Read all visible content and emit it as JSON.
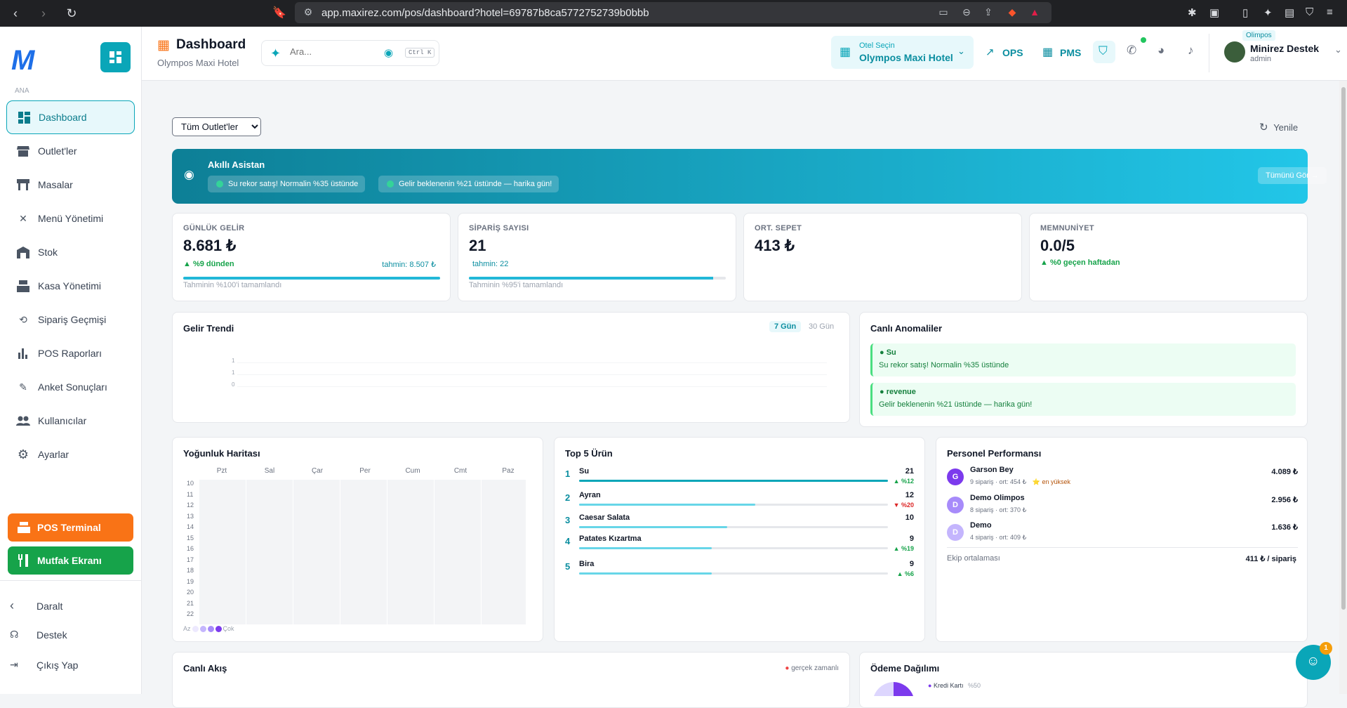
{
  "browser": {
    "url": "app.maxirez.com/pos/dashboard?hotel=69787b8ca5772752739b0bbb"
  },
  "sidebar": {
    "section_label": "ANA",
    "items": [
      {
        "label": "Dashboard",
        "icon": "dashboard-icon"
      },
      {
        "label": "Outlet'ler",
        "icon": "store-icon"
      },
      {
        "label": "Masalar",
        "icon": "table-icon"
      },
      {
        "label": "Menü Yönetimi",
        "icon": "utensils-icon"
      },
      {
        "label": "Stok",
        "icon": "warehouse-icon"
      },
      {
        "label": "Kasa Yönetimi",
        "icon": "cash-register-icon"
      },
      {
        "label": "Sipariş Geçmişi",
        "icon": "history-icon"
      },
      {
        "label": "POS Raporları",
        "icon": "bar-chart-icon"
      },
      {
        "label": "Anket Sonuçları",
        "icon": "survey-icon"
      },
      {
        "label": "Kullanıcılar",
        "icon": "users-icon"
      },
      {
        "label": "Ayarlar",
        "icon": "gear-icon"
      }
    ],
    "pos_terminal": "POS Terminal",
    "mutfak_ekrani": "Mutfak Ekranı",
    "collapse": "Daralt",
    "support": "Destek",
    "logout": "Çıkış Yap",
    "pos_color": "#f97316",
    "mutfak_color": "#16a34a"
  },
  "header": {
    "title": "Dashboard",
    "subtitle": "Olympos Maxi Hotel",
    "search_placeholder": "Ara...",
    "search_shortcut": "Ctrl K",
    "hotel_label": "Otel Seçin",
    "hotel_value": "Olympos Maxi Hotel",
    "ops": "OPS",
    "pms": "PMS",
    "user_name": "Minirez Destek",
    "user_role": "admin",
    "tenant": "Olimpos"
  },
  "toolbar": {
    "outlet_select": "Tüm Outlet'ler",
    "refresh": "Yenile"
  },
  "assistant": {
    "title": "Akıllı Asistan",
    "chips": [
      "Su rekor satış! Normalin %35 üstünde",
      "Gelir beklenenin %21 üstünde — harika gün!"
    ],
    "see_all": "Tümünü Gör →"
  },
  "kpis": [
    {
      "label": "GÜNLÜK GELİR",
      "value": "8.681 ₺",
      "delta": "▲ %9 dünden",
      "forecast": "tahmin: 8.507 ₺",
      "footer": "Tahminin %100'i tamamlandı",
      "progress": 100
    },
    {
      "label": "SİPARİŞ SAYISI",
      "value": "21",
      "delta": "",
      "forecast": "tahmin: 22",
      "footer": "Tahminin %95'i tamamlandı",
      "progress": 95
    },
    {
      "label": "ORT. SEPET",
      "value": "413 ₺"
    },
    {
      "label": "MEMNUNİYET",
      "value": "0.0/5",
      "delta": "▲ %0 geçen haftadan"
    }
  ],
  "trend": {
    "title": "Gelir Trendi",
    "range_7": "7 Gün",
    "range_30": "30 Gün",
    "ticks": [
      "1",
      "1",
      "0"
    ]
  },
  "anomalies": {
    "title": "Canlı Anomaliler",
    "items": [
      {
        "head": "Su",
        "body": "Su rekor satış! Normalin %35 üstünde"
      },
      {
        "head": "revenue",
        "body": "Gelir beklenenin %21 üstünde — harika gün!"
      }
    ]
  },
  "heatmap": {
    "title": "Yoğunluk Haritası",
    "days": [
      "Pzt",
      "Sal",
      "Çar",
      "Per",
      "Cum",
      "Cmt",
      "Paz"
    ],
    "hours": [
      "10",
      "11",
      "12",
      "13",
      "14",
      "15",
      "16",
      "17",
      "18",
      "19",
      "20",
      "21",
      "22"
    ],
    "legend_low": "Az",
    "legend_high": "Çok"
  },
  "top_products": {
    "title": "Top 5 Ürün",
    "items": [
      {
        "rank": "1",
        "name": "Su",
        "qty": "21",
        "trend": "▲ %12",
        "up": true,
        "share": 1.0
      },
      {
        "rank": "2",
        "name": "Ayran",
        "qty": "12",
        "trend": "▼ %20",
        "up": false,
        "share": 0.57
      },
      {
        "rank": "3",
        "name": "Caesar Salata",
        "qty": "10",
        "trend": "",
        "up": true,
        "share": 0.48
      },
      {
        "rank": "4",
        "name": "Patates Kızartma",
        "qty": "9",
        "trend": "▲ %19",
        "up": true,
        "share": 0.43
      },
      {
        "rank": "5",
        "name": "Bira",
        "qty": "9",
        "trend": "▲ %6",
        "up": true,
        "share": 0.43
      }
    ]
  },
  "staff": {
    "title": "Personel Performansı",
    "items": [
      {
        "initial": "G",
        "name": "Garson Bey",
        "stats": "9 sipariş · ort: 454 ₺",
        "badge": "⭐ en yüksek",
        "value": "4.089 ₺",
        "color": "#7c3aed"
      },
      {
        "initial": "D",
        "name": "Demo Olimpos",
        "stats": "8 sipariş · ort: 370 ₺",
        "badge": "",
        "value": "2.956 ₺",
        "color": "#a78bfa"
      },
      {
        "initial": "D",
        "name": "Demo",
        "stats": "4 sipariş · ort: 409 ₺",
        "badge": "",
        "value": "1.636 ₺",
        "color": "#c4b5fd"
      }
    ],
    "avg_label": "Ekip ortalaması",
    "avg_value": "411 ₺ / sipariş"
  },
  "live_flow": {
    "title": "Canlı Akış",
    "realtime": "gerçek zamanlı"
  },
  "payments": {
    "title": "Ödeme Dağılımı",
    "first_label": "Kredi Kartı",
    "first_pct": "%50"
  },
  "fab": {
    "badge": "1"
  }
}
